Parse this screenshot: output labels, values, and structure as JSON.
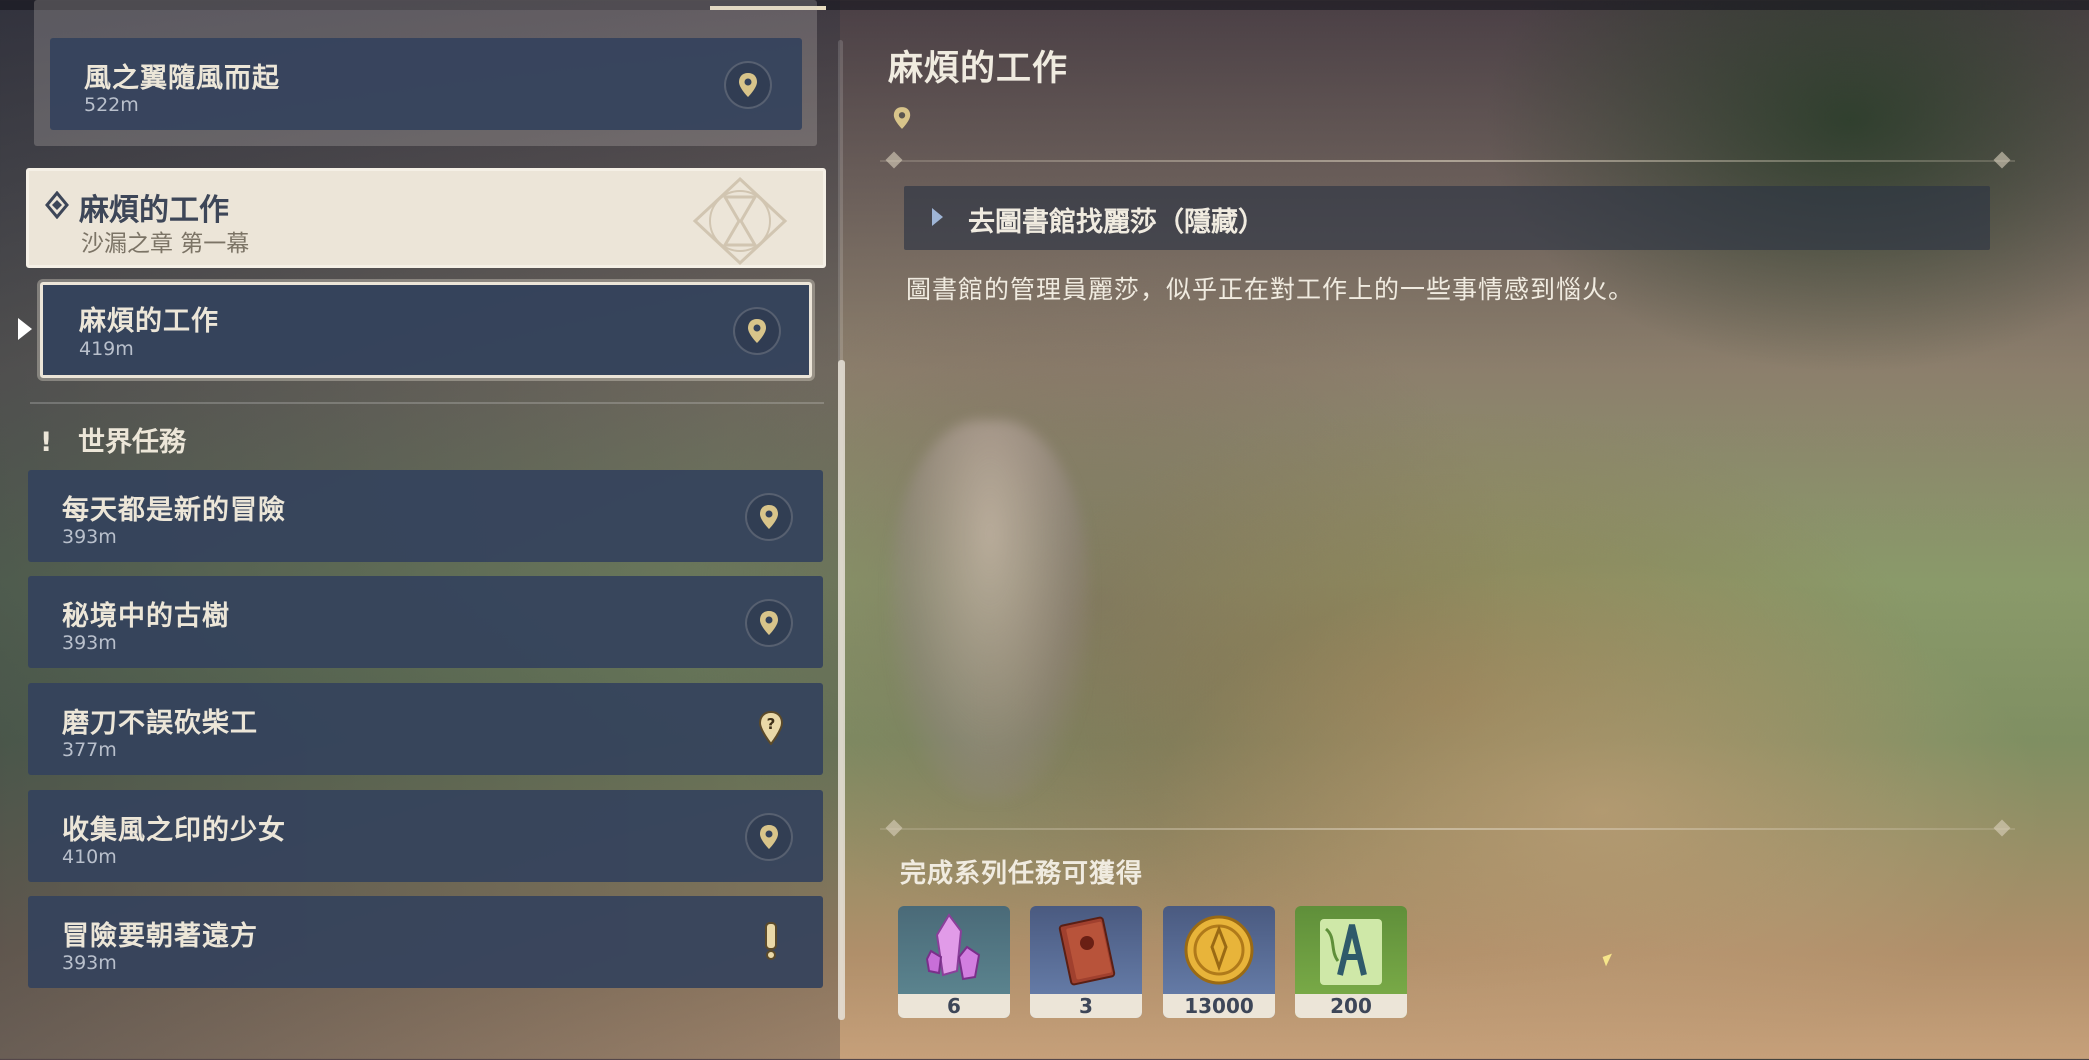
{
  "list": {
    "top_card": {
      "title": "風之翼隨風而起",
      "distance": "522m"
    },
    "header": {
      "title": "麻煩的工作",
      "subtitle": "沙漏之章 第一幕"
    },
    "selected": {
      "title": "麻煩的工作",
      "distance": "419m"
    },
    "section_label": "世界任務",
    "world_quests": [
      {
        "title": "每天都是新的冒險",
        "distance": "393m",
        "icon": "map-pin-icon"
      },
      {
        "title": "秘境中的古樹",
        "distance": "393m",
        "icon": "map-pin-icon"
      },
      {
        "title": "磨刀不誤砍柴工",
        "distance": "377m",
        "icon": "quest-question-icon"
      },
      {
        "title": "收集風之印的少女",
        "distance": "410m",
        "icon": "map-pin-icon"
      },
      {
        "title": "冒險要朝著遠方",
        "distance": "393m",
        "icon": "quest-exclamation-icon"
      }
    ]
  },
  "detail": {
    "title": "麻煩的工作",
    "step": "去圖書館找麗莎（隱藏）",
    "description": "圖書館的管理員麗莎，似乎正在對工作上的一些事情感到惱火。",
    "reward_label": "完成系列任務可獲得",
    "rewards": [
      {
        "name": "primogem-crystal-icon",
        "count": "6"
      },
      {
        "name": "heros-wit-book-icon",
        "count": "3"
      },
      {
        "name": "mora-coin-icon",
        "count": "13000"
      },
      {
        "name": "adventure-exp-icon",
        "count": "200"
      }
    ]
  },
  "colors": {
    "card_bg": "#34425c",
    "header_bg": "#ece5d8",
    "text_light": "#ece6d8",
    "pin_gold": "#d8c48a"
  }
}
